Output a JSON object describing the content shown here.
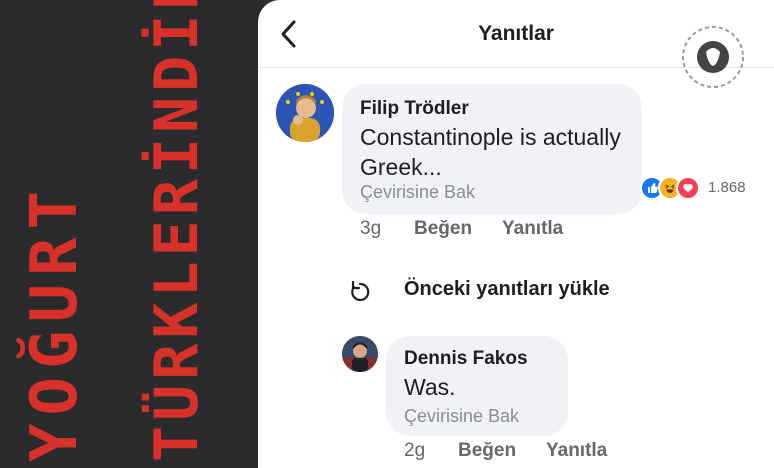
{
  "banner": {
    "line1": "YOĞURT",
    "line2": "TÜRKLERİNDİR"
  },
  "header": {
    "title": "Yanıtlar",
    "back_icon": "chevron-left-icon"
  },
  "comment": {
    "author": "Filip Trödler",
    "text": "Constantinople is actually Greek...",
    "see_translation": "Çevirisine Bak",
    "time": "3g",
    "like_label": "Beğen",
    "reply_label": "Yanıtla",
    "reactions": {
      "icons": [
        "like-icon",
        "haha-icon",
        "love-icon"
      ],
      "count": "1.868"
    }
  },
  "load_previous": {
    "label": "Önceki yanıtları yükle",
    "icon": "refresh-icon"
  },
  "reply": {
    "author": "Dennis Fakos",
    "text": "Was.",
    "see_translation": "Çevirisine Bak",
    "time": "2g",
    "like_label": "Beğen",
    "reply_label": "Yanıtla"
  },
  "colors": {
    "banner_bg": "#2b2b2d",
    "banner_text": "#d8312a",
    "bubble_bg": "#f0f2f5",
    "like_blue": "#1877f2",
    "love_red": "#f33e58",
    "haha_yellow": "#f7b125"
  }
}
